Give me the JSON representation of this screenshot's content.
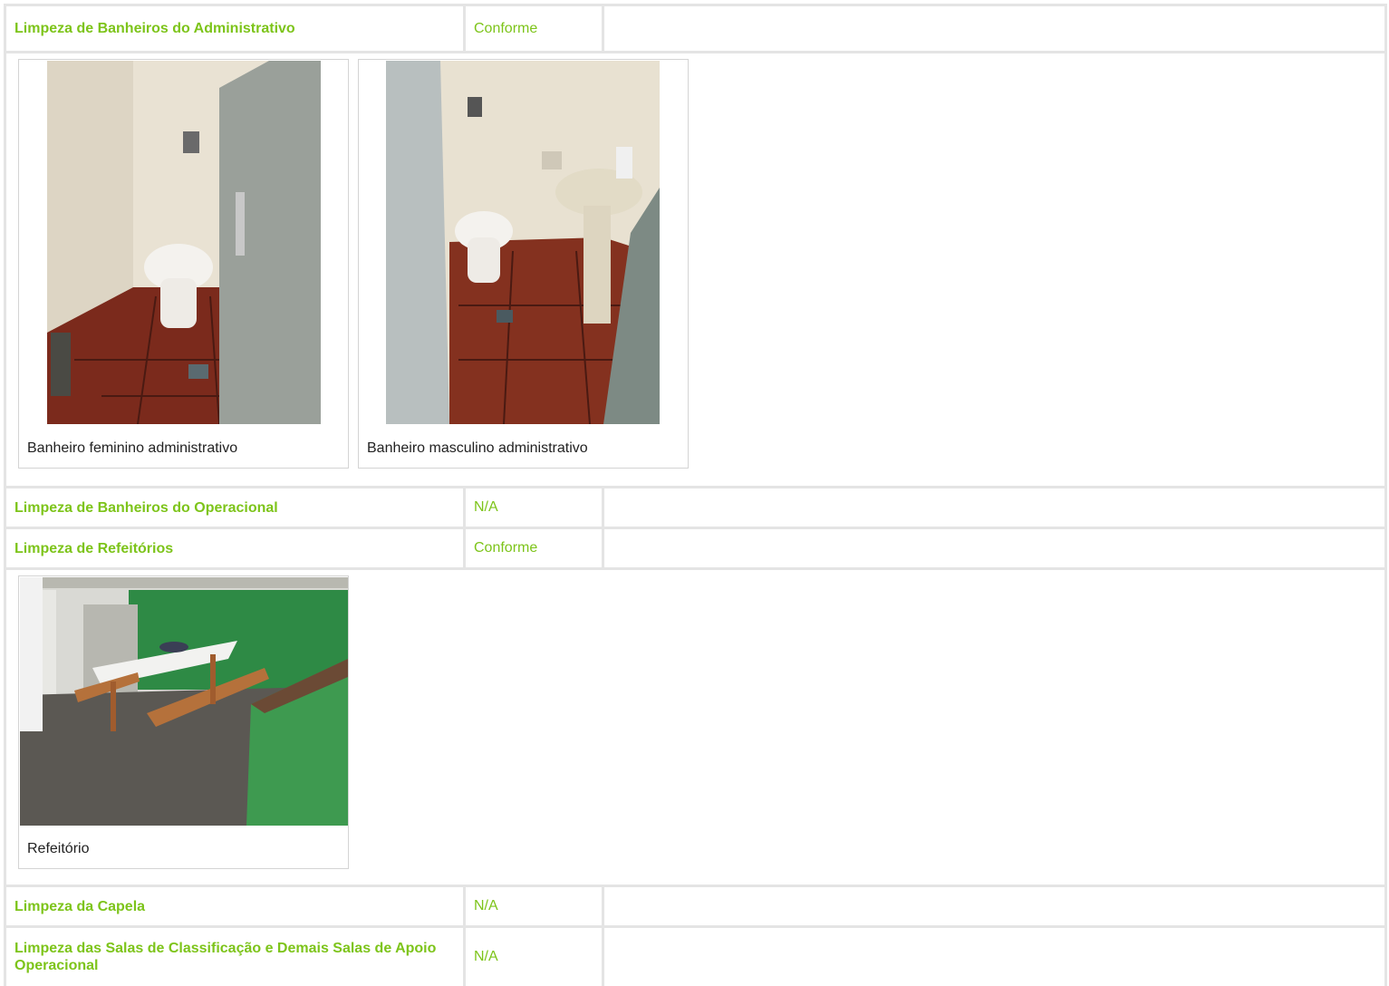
{
  "rows": [
    {
      "label": "Limpeza de Banheiros do Administrativo",
      "status": "Conforme"
    },
    {
      "label": "Limpeza de Banheiros do Operacional",
      "status": "N/A"
    },
    {
      "label": "Limpeza de Refeitórios",
      "status": "Conforme"
    },
    {
      "label": "Limpeza da Capela",
      "status": "N/A"
    },
    {
      "label": "Limpeza das Salas de Classificação e Demais Salas de Apoio Operacional",
      "status": "N/A"
    }
  ],
  "photos": [
    {
      "caption": "Banheiro feminino administrativo"
    },
    {
      "caption": "Banheiro masculino administrativo"
    },
    {
      "caption": "Refeitório"
    }
  ],
  "colors": {
    "accent": "#7dc41a",
    "grid": "#e4e4e4"
  }
}
